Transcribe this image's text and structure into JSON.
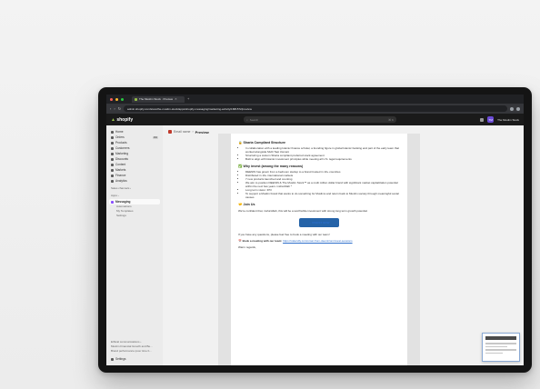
{
  "browser": {
    "tab_title": "The Muslim Stock · Preview",
    "url": "admin.shopify.com/store/the-muslim-stock/apps/shopify-messaging/marketing-activity/1681572/preview"
  },
  "topbar": {
    "logo_word": "shopify",
    "search_placeholder": "Search",
    "search_shortcut": "⌘ K",
    "avatar_initials": "TM",
    "store_name": "The Muslim Stock"
  },
  "sidebar": {
    "items": [
      {
        "label": "Home"
      },
      {
        "label": "Orders",
        "badge": "162"
      },
      {
        "label": "Products"
      },
      {
        "label": "Customers"
      },
      {
        "label": "Marketing"
      },
      {
        "label": "Discounts"
      },
      {
        "label": "Content"
      },
      {
        "label": "Markets"
      },
      {
        "label": "Finance"
      },
      {
        "label": "Analytics"
      }
    ],
    "sales_channels_label": "Sales channels ›",
    "apps_label": "Apps ›",
    "messaging": {
      "label": "Messaging",
      "sub": [
        "Automations",
        "My Templates",
        "Settings"
      ]
    },
    "bottom": [
      "Ethical communications ›",
      "Muslim Financial Growth and Be...",
      "Brand performance (over time b..."
    ],
    "settings_label": "Settings"
  },
  "breadcrumb": {
    "parent": "Email name",
    "title": "Preview"
  },
  "email": {
    "section1_title": "🔒 Sharia Compliant Structure",
    "section1_items": [
      "In collaboration with a leading Islamic finance scholar, a founding figure in global Islamic banking and part of the early team that worked alongside Mufti Taqi Usmani",
      "Structuring a custom Sharia compliant preferred stock agreement",
      "Built to align with Islamic investment principles while meeting all U.S. legal requirements"
    ],
    "section2_title": "✅ Why invest (among the many reasons)",
    "section2_items": [
      "DEENIN has grown from a bedroom startup to a brand trusted in 10+ countries",
      "Distributed in 10+ international markets",
      "7 new products launched and counting",
      "We aim to position DEENIN & The Muslim Stock™ as a multi million dollar brand with significant market capitalization potential within the next few years. insha'Allah *",
      "Long term vision: IPO",
      "To support a Muslim brand that wants to do something for Muslims and return back to Muslim society through meaningful social causes"
    ],
    "section3_title": "🤝 Join Us",
    "join_text": "We're confident that, insha'Allah, this will be a worthwhile investment with strong long term growth potential.",
    "cta_label": "→ INVEST NOW",
    "questions_text": "If you have any questions, please feel free to book a meeting with our team!",
    "book_prefix": "📅 Book a meeting with our team:",
    "book_link": "https://calendly.com/omar-from-deenin/ominvest-sessions",
    "signoff": "Warm regards,"
  },
  "colors": {
    "shopify_green": "#95bf47",
    "cta_blue": "#2563a8",
    "topbar": "#1a1a1a"
  }
}
